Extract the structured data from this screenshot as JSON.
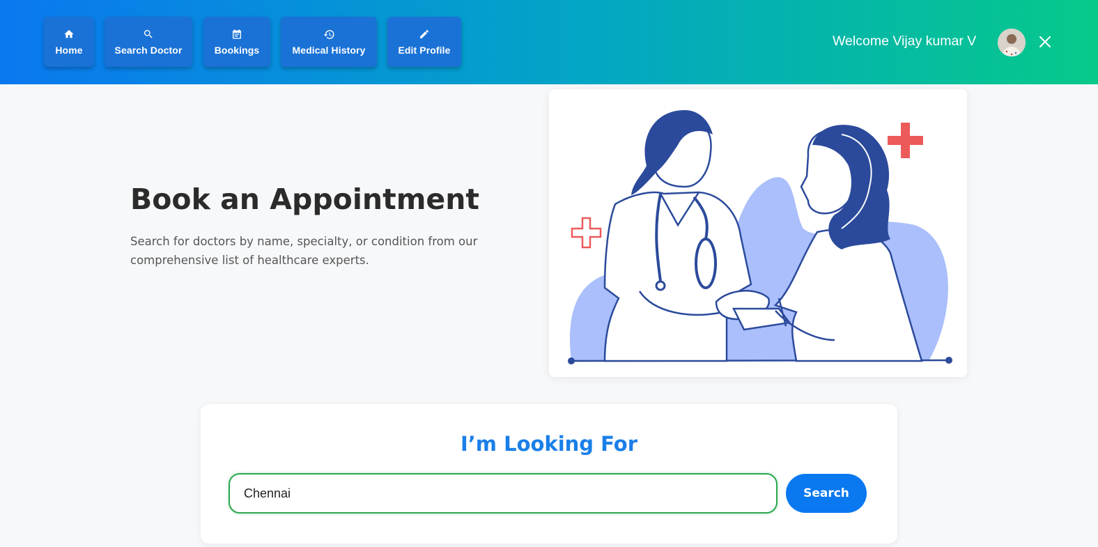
{
  "nav": {
    "items": [
      {
        "label": "Home",
        "icon": "home-icon"
      },
      {
        "label": "Search Doctor",
        "icon": "search-icon"
      },
      {
        "label": "Bookings",
        "icon": "calendar-icon"
      },
      {
        "label": "Medical History",
        "icon": "history-icon"
      },
      {
        "label": "Edit Profile",
        "icon": "pencil-icon"
      }
    ]
  },
  "header": {
    "welcome": "Welcome Vijay kumar V",
    "close_icon": "close-icon"
  },
  "hero": {
    "title": "Book an Appointment",
    "description": "Search for doctors by name, specialty, or condition from our comprehensive list of healthcare experts."
  },
  "search": {
    "title": "I’m Looking For",
    "value": "Chennai",
    "button": "Search"
  },
  "colors": {
    "gradient_start": "#0a78f0",
    "gradient_end": "#06c98a",
    "accent": "#1a7fe8",
    "input_border": "#2aa84e",
    "illustration_navy": "#2b4a9b",
    "illustration_blob": "#aabffb",
    "cross_red": "#ec5a5a"
  }
}
